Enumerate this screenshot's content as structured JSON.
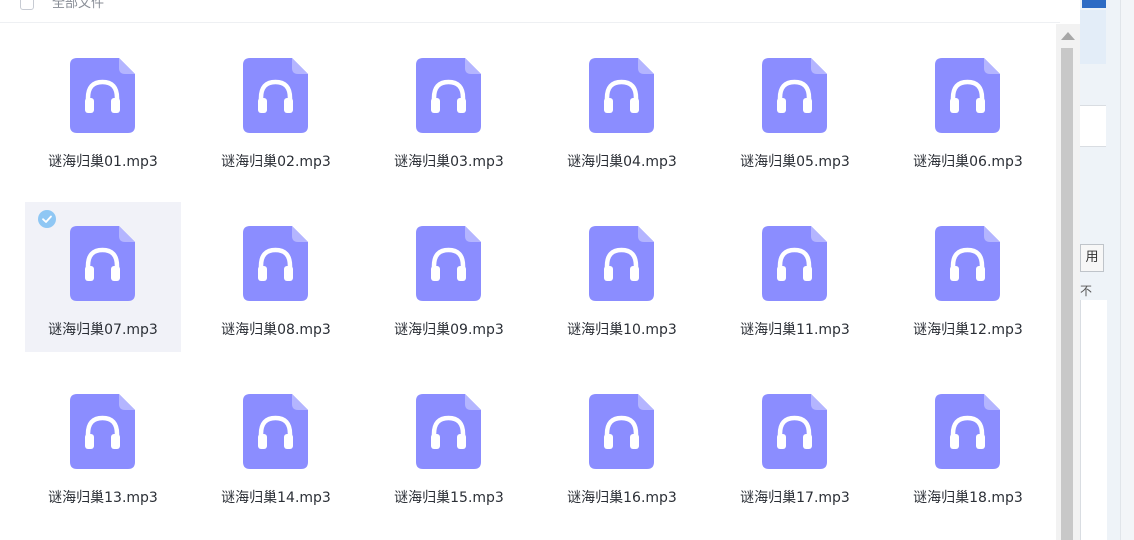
{
  "header": {
    "select_all_label": "全部文件"
  },
  "colors": {
    "file_icon": "#8b8dff",
    "selected_bg": "#f1f2f8",
    "check_badge": "#8fc7f4"
  },
  "files": [
    {
      "name": "谜海归巢01.mp3",
      "selected": false
    },
    {
      "name": "谜海归巢02.mp3",
      "selected": false
    },
    {
      "name": "谜海归巢03.mp3",
      "selected": false
    },
    {
      "name": "谜海归巢04.mp3",
      "selected": false
    },
    {
      "name": "谜海归巢05.mp3",
      "selected": false
    },
    {
      "name": "谜海归巢06.mp3",
      "selected": false
    },
    {
      "name": "谜海归巢07.mp3",
      "selected": true
    },
    {
      "name": "谜海归巢08.mp3",
      "selected": false
    },
    {
      "name": "谜海归巢09.mp3",
      "selected": false
    },
    {
      "name": "谜海归巢10.mp3",
      "selected": false
    },
    {
      "name": "谜海归巢11.mp3",
      "selected": false
    },
    {
      "name": "谜海归巢12.mp3",
      "selected": false
    },
    {
      "name": "谜海归巢13.mp3",
      "selected": false
    },
    {
      "name": "谜海归巢14.mp3",
      "selected": false
    },
    {
      "name": "谜海归巢15.mp3",
      "selected": false
    },
    {
      "name": "谜海归巢16.mp3",
      "selected": false
    },
    {
      "name": "谜海归巢17.mp3",
      "selected": false
    },
    {
      "name": "谜海归巢18.mp3",
      "selected": false
    }
  ],
  "side_panel": {
    "button_label": "用",
    "small_text": "不"
  }
}
